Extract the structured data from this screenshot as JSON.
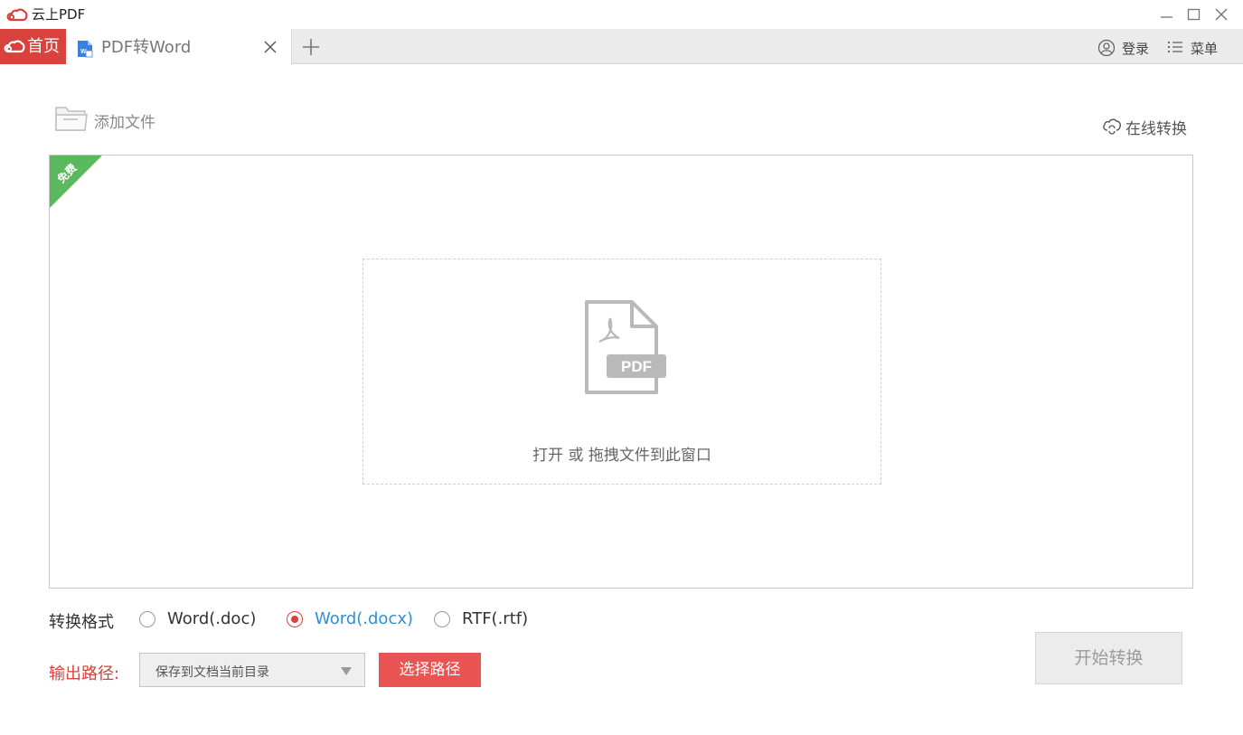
{
  "app": {
    "title": "云上PDF",
    "brand_color": "#d9413c"
  },
  "window_controls": {
    "minimize_icon": "minimize-icon",
    "maximize_icon": "maximize-icon",
    "close_icon": "close-icon"
  },
  "tabs": {
    "home_label": "首页",
    "active_label": "PDF转Word",
    "add_icon": "plus-icon"
  },
  "account": {
    "login_label": "登录",
    "menu_label": "菜单"
  },
  "toolbar": {
    "add_file_label": "添加文件",
    "online_convert_label": "在线转换"
  },
  "drop_area": {
    "ribbon_label": "免费",
    "pdf_badge": "PDF",
    "hint": "打开 或 拖拽文件到此窗口"
  },
  "format": {
    "label": "转换格式",
    "options": [
      {
        "label": "Word(.doc)",
        "selected": false
      },
      {
        "label": "Word(.docx)",
        "selected": true
      },
      {
        "label": "RTF(.rtf)",
        "selected": false
      }
    ],
    "selected_color": "#2f8fd8"
  },
  "output": {
    "label": "输出路径:",
    "path_value": "保存到文档当前目录",
    "choose_label": "选择路径",
    "start_label": "开始转换"
  }
}
